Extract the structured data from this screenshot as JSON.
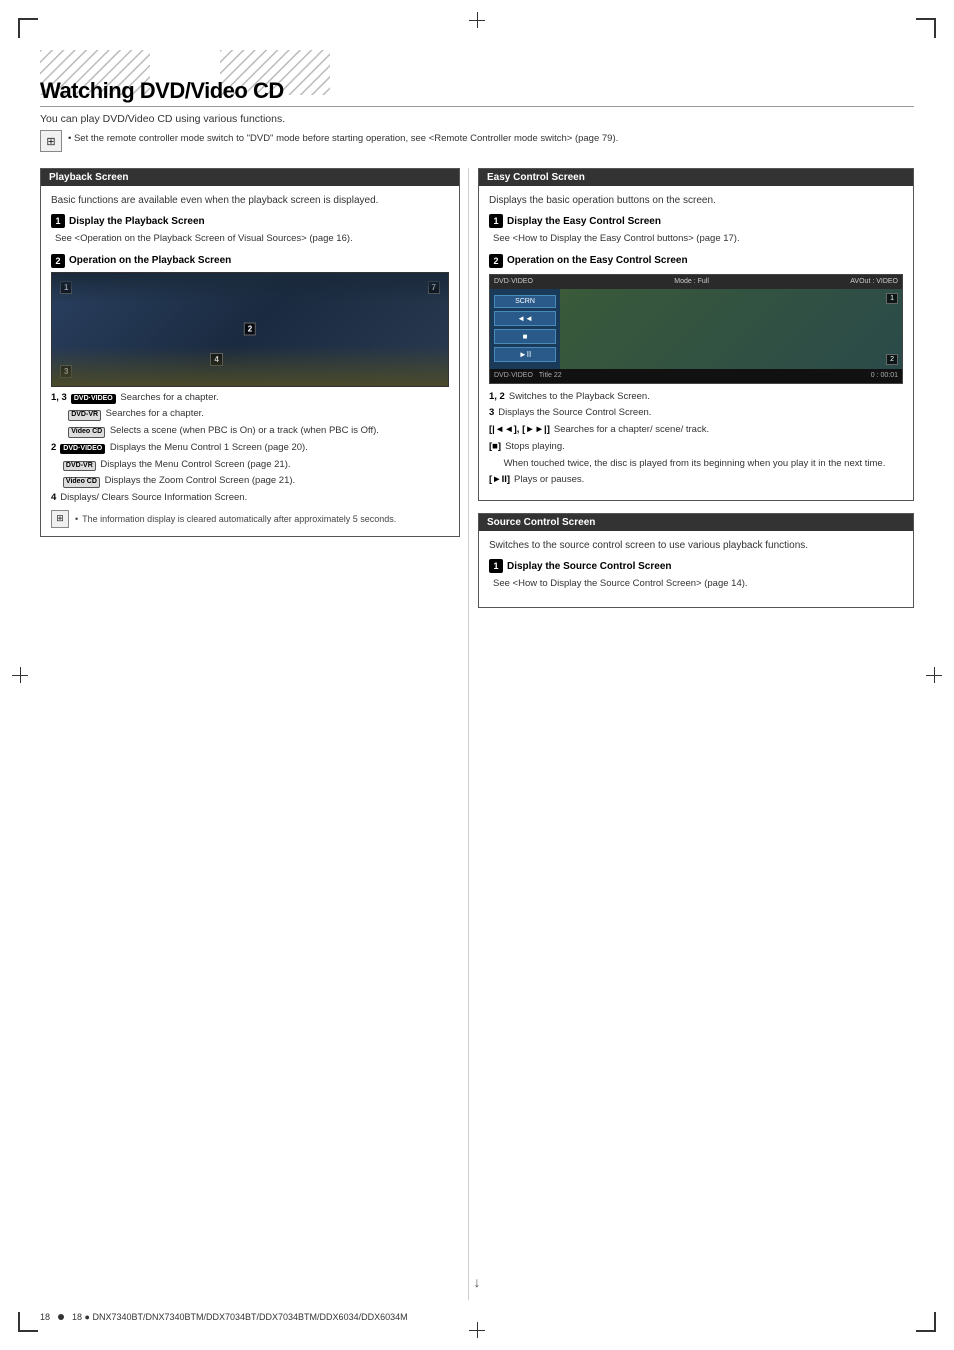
{
  "page": {
    "title": "Watching DVD/Video CD",
    "subtitle": "You can play DVD/Video CD using various functions.",
    "corner_marks": true,
    "footer_text": "18 ● DNX7340BT/DNX7340BTM/DDX7034BT/DDX7034BTM/DDX6034/DDX6034M"
  },
  "note": {
    "bullet": "Set the remote controller mode switch to \"DVD\" mode before starting operation, see <Remote Controller mode switch> (page 79)."
  },
  "playback_section": {
    "header": "Playback Screen",
    "description": "Basic functions are available even when the playback screen is displayed.",
    "sub1_title": "Display the Playback Screen",
    "sub1_body": "See <Operation on the Playback Screen of Visual Sources> (page 16).",
    "sub2_title": "Operation on the Playback Screen",
    "items": [
      {
        "nums": "1, 3",
        "badge": "DVD·VIDEO",
        "text": "Searches for a chapter."
      },
      {
        "nums": "",
        "badge": "DVD-VR",
        "text": "Searches for a chapter."
      },
      {
        "nums": "",
        "badge": "Video CD",
        "text": "Selects a scene (when PBC is On) or a track (when PBC is Off)."
      },
      {
        "nums": "2",
        "badge": "DVD·VIDEO",
        "text": "Displays the Menu Control 1 Screen (page 20)."
      },
      {
        "nums": "",
        "badge": "DVD-VR",
        "text": "Displays the Menu Control Screen (page 21)."
      },
      {
        "nums": "",
        "badge": "Video CD",
        "text": "Displays the Zoom Control Screen (page 21)."
      },
      {
        "nums": "4",
        "badge": "",
        "text": "Displays/ Clears Source Information Screen."
      }
    ],
    "note_text": "The information display is cleared automatically after approximately 5 seconds."
  },
  "easy_control_section": {
    "header": "Easy Control Screen",
    "description": "Displays the basic operation buttons on the screen.",
    "sub1_title": "Display the Easy Control Screen",
    "sub1_body": "See <How to Display the Easy Control buttons> (page 17).",
    "sub2_title": "Operation on the Easy Control Screen",
    "screen_labels": {
      "top_left": "DVD·VIDEO",
      "top_mode": "Mode : Full",
      "top_right": "AVOut : VIDEO",
      "btn_scrn": "SCRN",
      "title_label": "Title 22",
      "time_label": "0 : 00:01"
    },
    "items": [
      {
        "nums": "1, 2",
        "text": "Switches to the Playback Screen."
      },
      {
        "nums": "3",
        "text": "Displays the Source Control Screen."
      },
      {
        "nums": "[|◄◄], [►►|]",
        "text": "Searches for a chapter/ scene/ track."
      },
      {
        "nums": "[■]",
        "text": "Stops playing."
      },
      {
        "nums": "",
        "text": "When touched twice, the disc is played from its beginning when you play it in the next time."
      },
      {
        "nums": "[►II]",
        "text": "Plays or pauses."
      }
    ]
  },
  "source_control_section": {
    "header": "Source Control Screen",
    "description": "Switches to the source control screen to use various playback functions.",
    "sub1_title": "Display the Source Control Screen",
    "sub1_body": "See <How to Display the Source Control Screen> (page 14)."
  },
  "icons": {
    "remote": "⊞",
    "bullet": "•",
    "arrow_down": "↓"
  }
}
